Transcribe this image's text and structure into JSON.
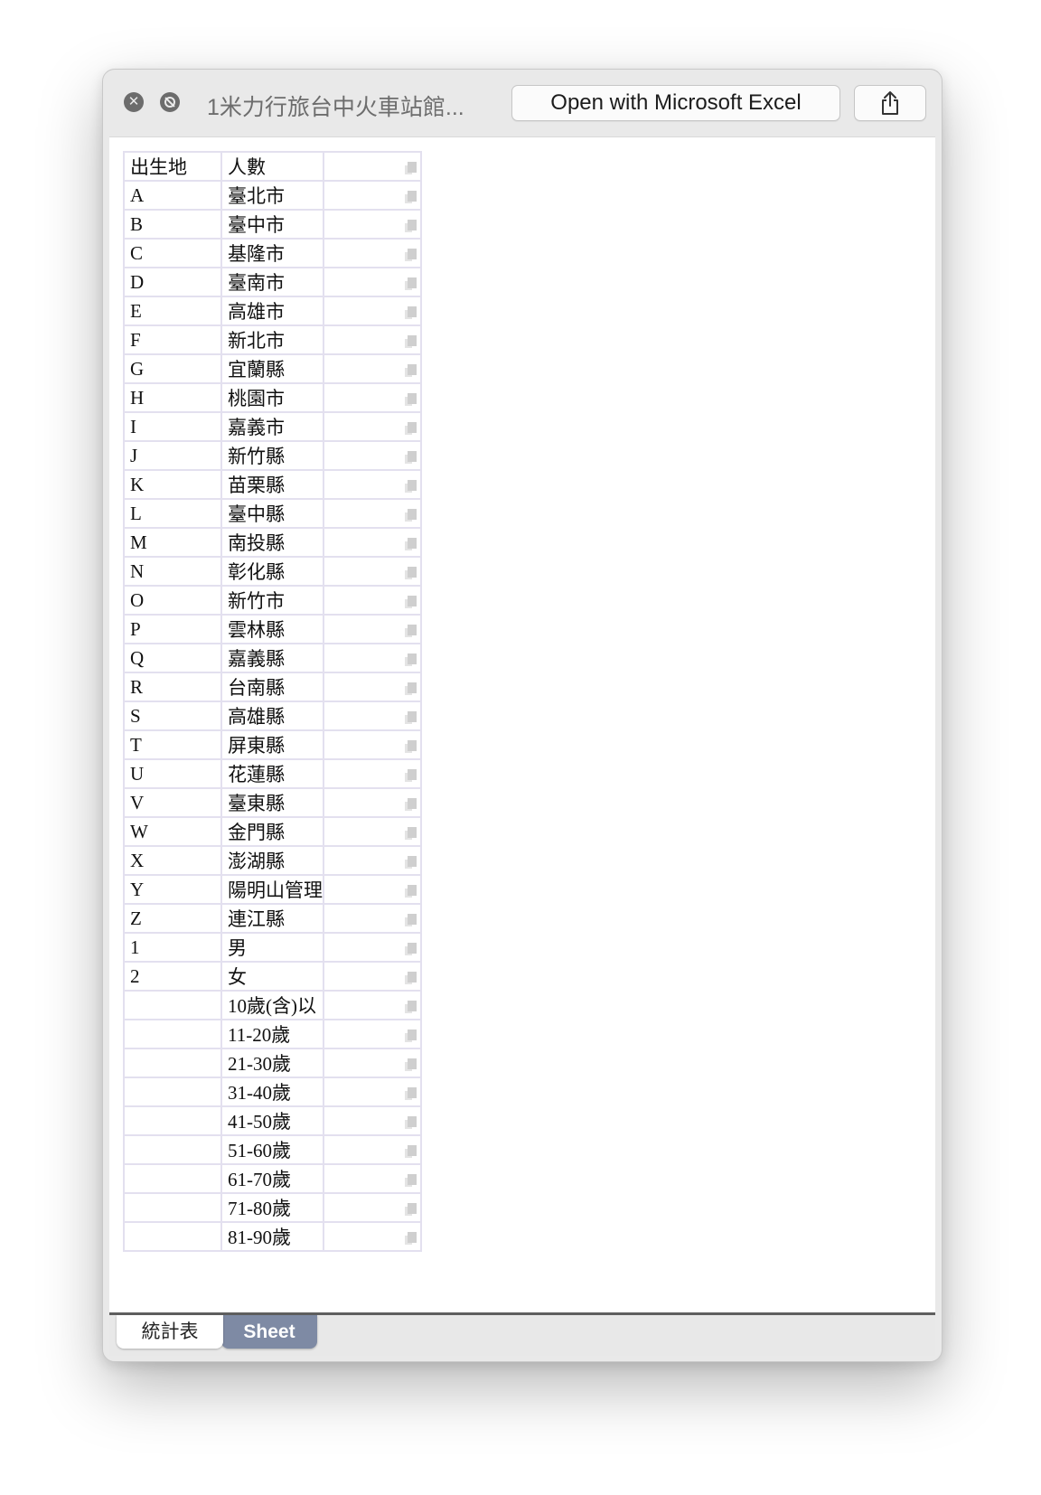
{
  "window": {
    "title": "1米力行旅台中火車站館...",
    "open_with_label": "Open with Microsoft Excel",
    "close_icon": "close-icon",
    "share_icon": "share-icon"
  },
  "table": {
    "headers": [
      "出生地",
      "人數",
      ""
    ],
    "rows": [
      {
        "code": "A",
        "name": "臺北市"
      },
      {
        "code": "B",
        "name": "臺中市"
      },
      {
        "code": "C",
        "name": "基隆市"
      },
      {
        "code": "D",
        "name": "臺南市"
      },
      {
        "code": "E",
        "name": "高雄市"
      },
      {
        "code": "F",
        "name": "新北市"
      },
      {
        "code": "G",
        "name": "宜蘭縣"
      },
      {
        "code": "H",
        "name": "桃園市"
      },
      {
        "code": "I",
        "name": "嘉義市"
      },
      {
        "code": "J",
        "name": "新竹縣"
      },
      {
        "code": "K",
        "name": "苗栗縣"
      },
      {
        "code": "L",
        "name": "臺中縣"
      },
      {
        "code": "M",
        "name": "南投縣"
      },
      {
        "code": "N",
        "name": "彰化縣"
      },
      {
        "code": "O",
        "name": "新竹市"
      },
      {
        "code": "P",
        "name": "雲林縣"
      },
      {
        "code": "Q",
        "name": "嘉義縣"
      },
      {
        "code": "R",
        "name": "台南縣"
      },
      {
        "code": "S",
        "name": "高雄縣"
      },
      {
        "code": "T",
        "name": "屏東縣"
      },
      {
        "code": "U",
        "name": "花蓮縣"
      },
      {
        "code": "V",
        "name": "臺東縣"
      },
      {
        "code": "W",
        "name": "金門縣"
      },
      {
        "code": "X",
        "name": "澎湖縣"
      },
      {
        "code": "Y",
        "name": "陽明山管理"
      },
      {
        "code": "Z",
        "name": "連江縣"
      },
      {
        "code": "1",
        "name": "男"
      },
      {
        "code": "2",
        "name": "女"
      },
      {
        "code": "",
        "name": "10歲(含)以"
      },
      {
        "code": "",
        "name": "11-20歲"
      },
      {
        "code": "",
        "name": "21-30歲"
      },
      {
        "code": "",
        "name": "31-40歲"
      },
      {
        "code": "",
        "name": "41-50歲"
      },
      {
        "code": "",
        "name": "51-60歲"
      },
      {
        "code": "",
        "name": "61-70歲"
      },
      {
        "code": "",
        "name": "71-80歲"
      },
      {
        "code": "",
        "name": "81-90歲"
      }
    ]
  },
  "sheets": [
    {
      "label": "統計表",
      "active": false
    },
    {
      "label": "Sheet",
      "active": true
    }
  ]
}
